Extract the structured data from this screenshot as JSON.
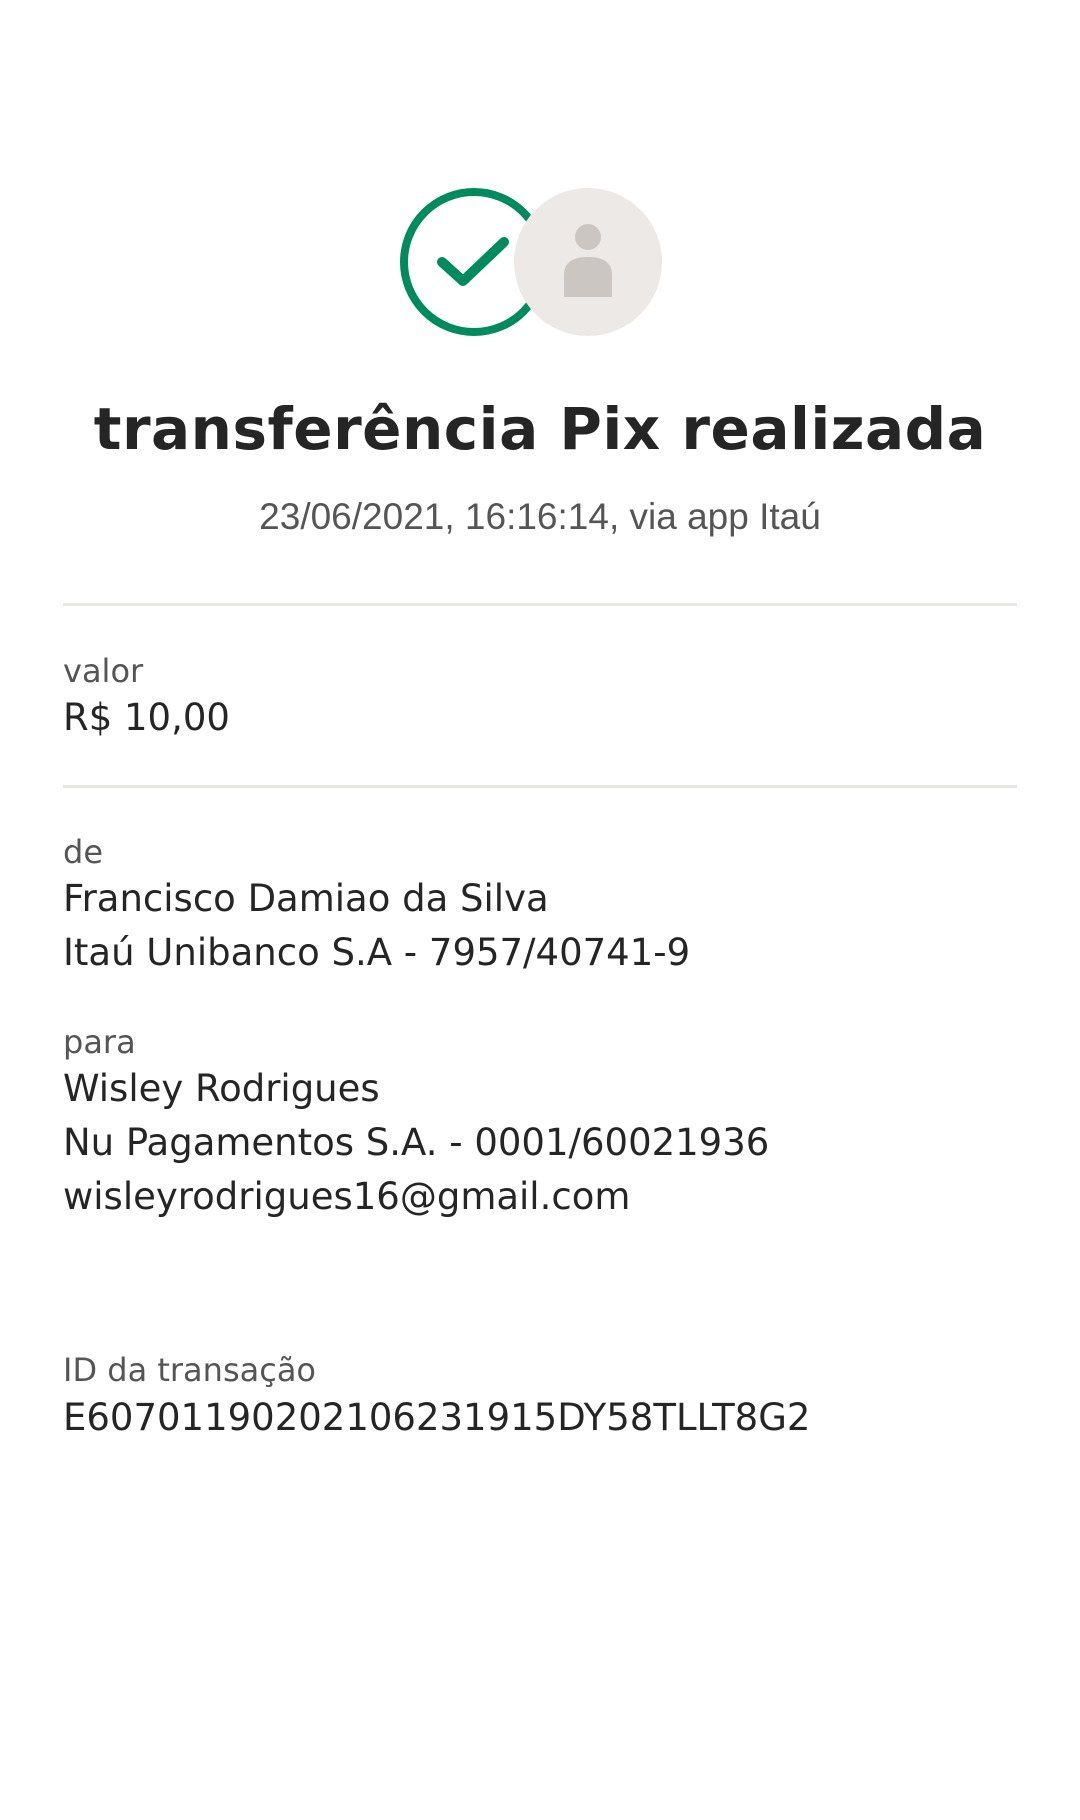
{
  "header": {
    "title": "transferência Pix realizada",
    "subtitle": "23/06/2021,  16:16:14, via app Itaú",
    "status_icon": "check-circle-icon",
    "avatar_icon": "person-icon",
    "colors": {
      "success": "#008a5e",
      "avatar_bg": "#ede9e6",
      "avatar_fg": "#ccc6c2"
    }
  },
  "amount": {
    "label": "valor",
    "value": "R$ 10,00"
  },
  "sender": {
    "label": "de",
    "name": "Francisco Damiao da Silva",
    "account": "Itaú Unibanco S.A - 7957/40741-9"
  },
  "receiver": {
    "label": "para",
    "name": "Wisley Rodrigues",
    "account": "Nu Pagamentos S.A. - 0001/60021936",
    "key": "wisleyrodrigues16@gmail.com"
  },
  "transaction": {
    "label": "ID da transação",
    "id": "E60701190202106231915DY58TLLT8G2"
  }
}
